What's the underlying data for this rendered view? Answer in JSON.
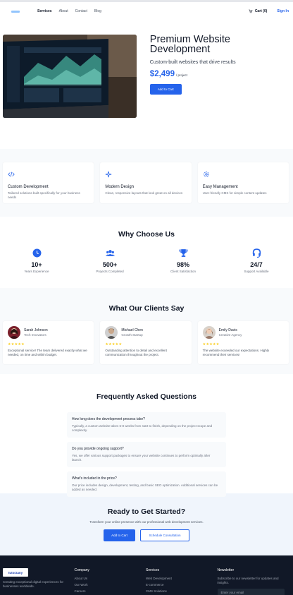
{
  "nav": {
    "links": [
      "Services",
      "About",
      "Contact",
      "Blog"
    ],
    "cart_label": "Cart (0)",
    "signin_label": "Sign In"
  },
  "hero": {
    "title": "Premium Website Development",
    "subtitle": "Custom-built websites that drive results",
    "price": "$2,499",
    "price_unit": "/ project",
    "add_to_cart": "Add to Cart"
  },
  "services": [
    {
      "icon": "code-icon",
      "title": "Custom Development",
      "desc": "Tailored solutions built specifically for your business needs"
    },
    {
      "icon": "sparkle-icon",
      "title": "Modern Design",
      "desc": "Clean, responsive layouts that look great on all devices"
    },
    {
      "icon": "gear-icon",
      "title": "Easy Management",
      "desc": "User-friendly CMS for simple content updates"
    }
  ],
  "why": {
    "title": "Why Choose Us",
    "stats": [
      {
        "icon": "clock-icon",
        "value": "10+",
        "label": "Years Experience"
      },
      {
        "icon": "users-icon",
        "value": "500+",
        "label": "Projects Completed"
      },
      {
        "icon": "trophy-icon",
        "value": "98%",
        "label": "Client Satisfaction"
      },
      {
        "icon": "headset-icon",
        "value": "24/7",
        "label": "Support Available"
      }
    ]
  },
  "testimonials": {
    "title": "What Our Clients Say",
    "items": [
      {
        "name": "Sarah Johnson",
        "role": "Tech Innovators",
        "stars": "★★★★★",
        "text": "Exceptional service! The team delivered exactly what we needed, on time and within budget."
      },
      {
        "name": "Michael Chen",
        "role": "Growth Startup",
        "stars": "★★★★★",
        "text": "Outstanding attention to detail and excellent communication throughout the project."
      },
      {
        "name": "Emily Davis",
        "role": "Creative Agency",
        "stars": "★★★★★",
        "text": "The website exceeded our expectations. Highly recommend their services!"
      }
    ]
  },
  "faq": {
    "title": "Frequently Asked Questions",
    "items": [
      {
        "q": "How long does the development process take?",
        "a": "Typically, a custom website takes 6-8 weeks from start to finish, depending on the project scope and complexity."
      },
      {
        "q": "Do you provide ongoing support?",
        "a": "Yes, we offer various support packages to ensure your website continues to perform optimally after launch."
      },
      {
        "q": "What's included in the price?",
        "a": "Our price includes design, development, testing, and basic SEO optimization. Additional services can be added as needed."
      }
    ]
  },
  "cta": {
    "title": "Ready to Get Started?",
    "subtitle": "Transform your online presence with our professional web development services.",
    "add_to_cart": "Add to Cart",
    "schedule": "Schedule Consultation"
  },
  "footer": {
    "logo_text": "tutorzany",
    "tagline": "Creating exceptional digital experiences for businesses worldwide.",
    "company_head": "Company",
    "company_links": [
      "About Us",
      "Our Work",
      "Careers"
    ],
    "services_head": "Services",
    "services_links": [
      "Web Development",
      "E-commerce",
      "CMS Solutions"
    ],
    "newsletter_head": "Newsletter",
    "newsletter_text": "Subscribe to our newsletter for updates and insights.",
    "email_placeholder": "Enter your email"
  },
  "colors": {
    "accent": "#2563eb",
    "star": "#facc15",
    "footer_bg": "#111827"
  }
}
